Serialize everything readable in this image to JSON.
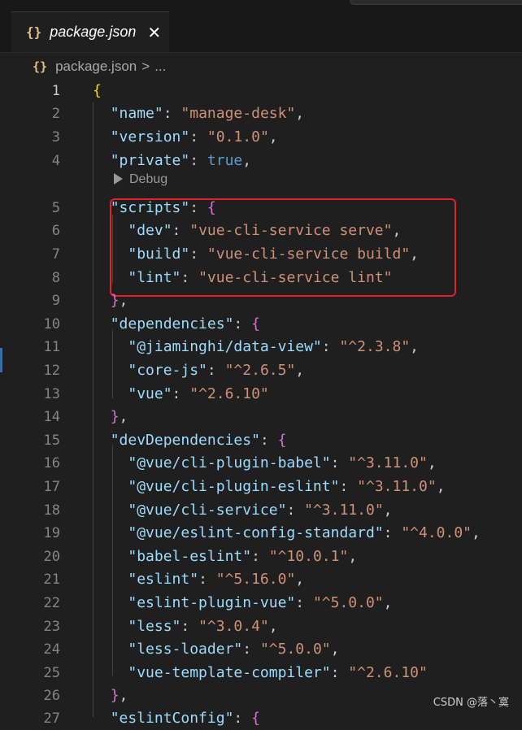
{
  "tab": {
    "title": "package.json",
    "icon": "brace-icon",
    "close": "✕"
  },
  "breadcrumb": {
    "file": "package.json",
    "sep": ">",
    "more": "..."
  },
  "codelens": {
    "label": "Debug"
  },
  "watermark": "CSDN @落丶寞",
  "colors": {
    "key": "#9cdcfe",
    "string": "#ce9178",
    "keyword": "#569cd6",
    "bracket1": "#ffd700",
    "bracket2": "#da70d6",
    "highlight": "#e5202a"
  },
  "lines": [
    {
      "n": "1",
      "tokens": [
        [
          "b1",
          "{"
        ]
      ]
    },
    {
      "n": "2",
      "tokens": [
        [
          "p",
          "  "
        ],
        [
          "k",
          "\"name\""
        ],
        [
          "p",
          ": "
        ],
        [
          "s",
          "\"manage-desk\""
        ],
        [
          "p",
          ","
        ]
      ]
    },
    {
      "n": "3",
      "tokens": [
        [
          "p",
          "  "
        ],
        [
          "k",
          "\"version\""
        ],
        [
          "p",
          ": "
        ],
        [
          "s",
          "\"0.1.0\""
        ],
        [
          "p",
          ","
        ]
      ]
    },
    {
      "n": "4",
      "tokens": [
        [
          "p",
          "  "
        ],
        [
          "k",
          "\"private\""
        ],
        [
          "p",
          ": "
        ],
        [
          "kw",
          "true"
        ],
        [
          "p",
          ","
        ]
      ]
    },
    {
      "n": "5",
      "tokens": [
        [
          "p",
          "  "
        ],
        [
          "k",
          "\"scripts\""
        ],
        [
          "p",
          ": "
        ],
        [
          "b2",
          "{"
        ]
      ]
    },
    {
      "n": "6",
      "tokens": [
        [
          "p",
          "    "
        ],
        [
          "k",
          "\"dev\""
        ],
        [
          "p",
          ": "
        ],
        [
          "s",
          "\"vue-cli-service serve\""
        ],
        [
          "p",
          ","
        ]
      ]
    },
    {
      "n": "7",
      "tokens": [
        [
          "p",
          "    "
        ],
        [
          "k",
          "\"build\""
        ],
        [
          "p",
          ": "
        ],
        [
          "s",
          "\"vue-cli-service build\""
        ],
        [
          "p",
          ","
        ]
      ]
    },
    {
      "n": "8",
      "tokens": [
        [
          "p",
          "    "
        ],
        [
          "k",
          "\"lint\""
        ],
        [
          "p",
          ": "
        ],
        [
          "s",
          "\"vue-cli-service lint\""
        ]
      ]
    },
    {
      "n": "9",
      "tokens": [
        [
          "p",
          "  "
        ],
        [
          "b2",
          "}"
        ],
        [
          "p",
          ","
        ]
      ]
    },
    {
      "n": "10",
      "tokens": [
        [
          "p",
          "  "
        ],
        [
          "k",
          "\"dependencies\""
        ],
        [
          "p",
          ": "
        ],
        [
          "b2",
          "{"
        ]
      ]
    },
    {
      "n": "11",
      "tokens": [
        [
          "p",
          "    "
        ],
        [
          "k",
          "\"@jiaminghi/data-view\""
        ],
        [
          "p",
          ": "
        ],
        [
          "s",
          "\"^2.3.8\""
        ],
        [
          "p",
          ","
        ]
      ]
    },
    {
      "n": "12",
      "tokens": [
        [
          "p",
          "    "
        ],
        [
          "k",
          "\"core-js\""
        ],
        [
          "p",
          ": "
        ],
        [
          "s",
          "\"^2.6.5\""
        ],
        [
          "p",
          ","
        ]
      ]
    },
    {
      "n": "13",
      "tokens": [
        [
          "p",
          "    "
        ],
        [
          "k",
          "\"vue\""
        ],
        [
          "p",
          ": "
        ],
        [
          "s",
          "\"^2.6.10\""
        ]
      ]
    },
    {
      "n": "14",
      "tokens": [
        [
          "p",
          "  "
        ],
        [
          "b2",
          "}"
        ],
        [
          "p",
          ","
        ]
      ]
    },
    {
      "n": "15",
      "tokens": [
        [
          "p",
          "  "
        ],
        [
          "k",
          "\"devDependencies\""
        ],
        [
          "p",
          ": "
        ],
        [
          "b2",
          "{"
        ]
      ]
    },
    {
      "n": "16",
      "tokens": [
        [
          "p",
          "    "
        ],
        [
          "k",
          "\"@vue/cli-plugin-babel\""
        ],
        [
          "p",
          ": "
        ],
        [
          "s",
          "\"^3.11.0\""
        ],
        [
          "p",
          ","
        ]
      ]
    },
    {
      "n": "17",
      "tokens": [
        [
          "p",
          "    "
        ],
        [
          "k",
          "\"@vue/cli-plugin-eslint\""
        ],
        [
          "p",
          ": "
        ],
        [
          "s",
          "\"^3.11.0\""
        ],
        [
          "p",
          ","
        ]
      ]
    },
    {
      "n": "18",
      "tokens": [
        [
          "p",
          "    "
        ],
        [
          "k",
          "\"@vue/cli-service\""
        ],
        [
          "p",
          ": "
        ],
        [
          "s",
          "\"^3.11.0\""
        ],
        [
          "p",
          ","
        ]
      ]
    },
    {
      "n": "19",
      "tokens": [
        [
          "p",
          "    "
        ],
        [
          "k",
          "\"@vue/eslint-config-standard\""
        ],
        [
          "p",
          ": "
        ],
        [
          "s",
          "\"^4.0.0\""
        ],
        [
          "p",
          ","
        ]
      ]
    },
    {
      "n": "20",
      "tokens": [
        [
          "p",
          "    "
        ],
        [
          "k",
          "\"babel-eslint\""
        ],
        [
          "p",
          ": "
        ],
        [
          "s",
          "\"^10.0.1\""
        ],
        [
          "p",
          ","
        ]
      ]
    },
    {
      "n": "21",
      "tokens": [
        [
          "p",
          "    "
        ],
        [
          "k",
          "\"eslint\""
        ],
        [
          "p",
          ": "
        ],
        [
          "s",
          "\"^5.16.0\""
        ],
        [
          "p",
          ","
        ]
      ]
    },
    {
      "n": "22",
      "tokens": [
        [
          "p",
          "    "
        ],
        [
          "k",
          "\"eslint-plugin-vue\""
        ],
        [
          "p",
          ": "
        ],
        [
          "s",
          "\"^5.0.0\""
        ],
        [
          "p",
          ","
        ]
      ]
    },
    {
      "n": "23",
      "tokens": [
        [
          "p",
          "    "
        ],
        [
          "k",
          "\"less\""
        ],
        [
          "p",
          ": "
        ],
        [
          "s",
          "\"^3.0.4\""
        ],
        [
          "p",
          ","
        ]
      ]
    },
    {
      "n": "24",
      "tokens": [
        [
          "p",
          "    "
        ],
        [
          "k",
          "\"less-loader\""
        ],
        [
          "p",
          ": "
        ],
        [
          "s",
          "\"^5.0.0\""
        ],
        [
          "p",
          ","
        ]
      ]
    },
    {
      "n": "25",
      "tokens": [
        [
          "p",
          "    "
        ],
        [
          "k",
          "\"vue-template-compiler\""
        ],
        [
          "p",
          ": "
        ],
        [
          "s",
          "\"^2.6.10\""
        ]
      ]
    },
    {
      "n": "26",
      "tokens": [
        [
          "p",
          "  "
        ],
        [
          "b2",
          "}"
        ],
        [
          "p",
          ","
        ]
      ]
    },
    {
      "n": "27",
      "tokens": [
        [
          "p",
          "  "
        ],
        [
          "k",
          "\"eslintConfig\""
        ],
        [
          "p",
          ": "
        ],
        [
          "b2",
          "{"
        ]
      ]
    }
  ]
}
